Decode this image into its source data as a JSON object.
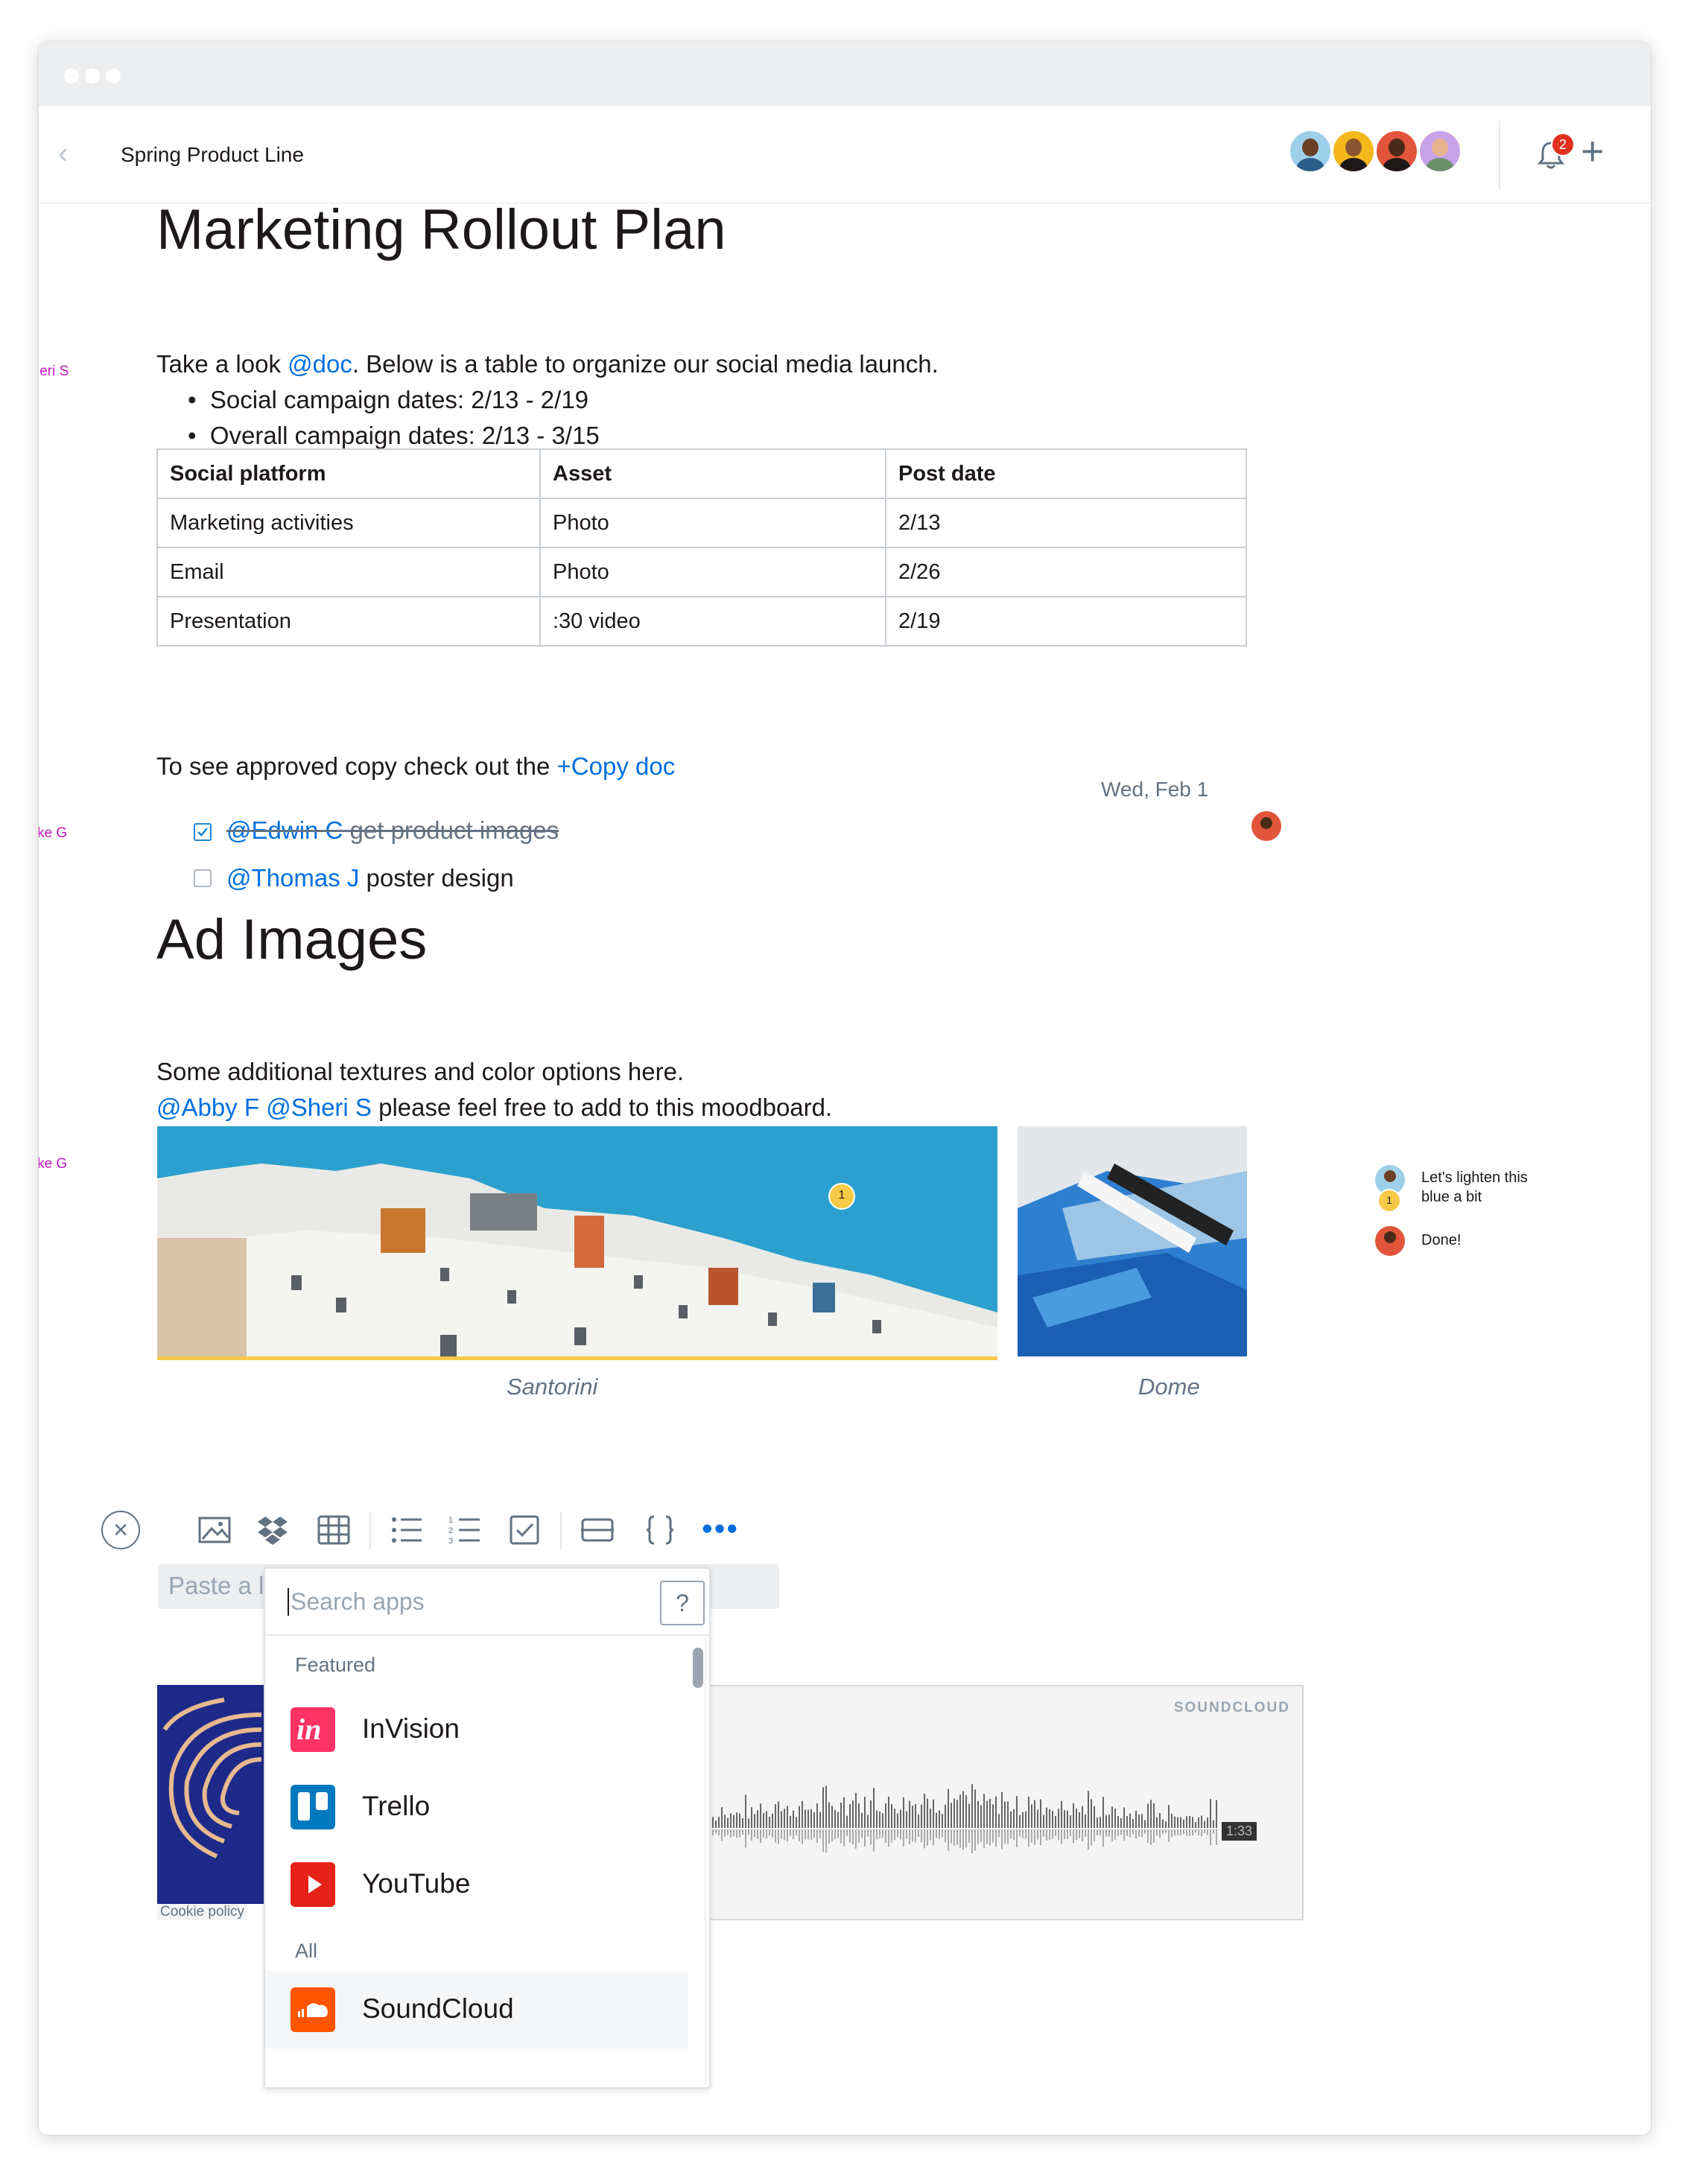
{
  "topbar": {
    "back_label": "‹",
    "doc_title": "Spring Product Line",
    "notification_count": "2",
    "add_label": "+"
  },
  "doc": {
    "title": "Marketing Rollout Plan",
    "authors": {
      "sheri": "Sheri S",
      "jake1": "Jake G",
      "jake2": "Jake G"
    },
    "intro_before": "Take a look ",
    "intro_mention": "@doc",
    "intro_after": ". Below is a table to organize our social media launch.",
    "bullets": [
      "Social campaign dates: 2/13 - 2/19",
      "Overall campaign dates: 2/13 - 3/15"
    ],
    "table": {
      "headers": [
        "Social platform",
        "Asset",
        "Post date"
      ],
      "rows": [
        [
          "Marketing activities",
          "Photo",
          "2/13"
        ],
        [
          "Email",
          "Photo",
          "2/26"
        ],
        [
          "Presentation",
          ":30 video",
          "2/19"
        ]
      ]
    },
    "copy_text": "To see approved copy check out the ",
    "copy_link": "+Copy doc",
    "tasks": [
      {
        "mention": "@Edwin C",
        "text": " get product images",
        "done": true,
        "date": "Wed, Feb 1"
      },
      {
        "mention": "@Thomas J",
        "text": " poster design",
        "done": false
      }
    ],
    "section2_title": "Ad Images",
    "section2_line1": "Some additional textures and color options here.",
    "section2_mention1": "@Abby F",
    "section2_mention2": "@Sheri S",
    "section2_line2_rest": " please feel free to add to this moodboard.",
    "images": [
      {
        "caption": "Santorini",
        "comment_count": "1"
      },
      {
        "caption": "Dome"
      }
    ],
    "comments": [
      {
        "text1": "Let's lighten this",
        "text2": "blue a bit",
        "count": "1"
      },
      {
        "text1": "Done!"
      }
    ]
  },
  "toolbar": {
    "close_label": "×",
    "more_label": "•••",
    "paste_placeholder": "Paste a li"
  },
  "embeds": {
    "cookie_label": "Cookie policy",
    "soundcloud_logo": "SOUNDCLOUD",
    "soundcloud_time": "1:33"
  },
  "app_picker": {
    "search_placeholder": "Search apps",
    "help_label": "?",
    "featured_label": "Featured",
    "all_label": "All",
    "featured": [
      {
        "name": "InVision",
        "icon": "invision-icon",
        "color": "#ff3366"
      },
      {
        "name": "Trello",
        "icon": "trello-icon",
        "color": "#0079bf"
      },
      {
        "name": "YouTube",
        "icon": "youtube-icon",
        "color": "#e62117"
      }
    ],
    "all": [
      {
        "name": "SoundCloud",
        "icon": "soundcloud-icon",
        "color": "#ff5500"
      }
    ]
  },
  "colors": {
    "mention": "#0070e0",
    "author": "#c316c0",
    "highlight": "#f7c948"
  }
}
